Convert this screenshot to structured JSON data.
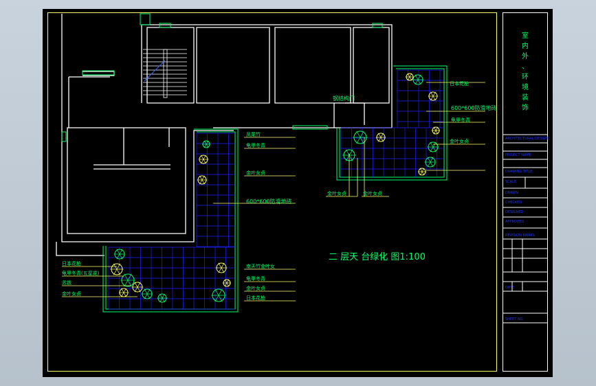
{
  "drawing": {
    "title": "二 层天 台绿化 图1:100",
    "labels": {
      "tile_top": "600*600防滑地砖",
      "tile_left": "600*600防滑地砖",
      "rect_room": "钢结构门",
      "right_r1": "日本花柏",
      "right_r2": "龟甲冬青",
      "right_r3": "金叶女贞",
      "center_t1": "凤尾竹",
      "center_t2": "龟甲冬青",
      "center_t3": "金叶女贞",
      "lower_bottom_l": "金叶女贞",
      "lower_bottom_r": "金叶女贞",
      "center_b1": "南天竹金叶女",
      "center_b2": "龟甲冬青",
      "center_b3": "金叶女贞",
      "center_b4": "日本花柏",
      "left_l1": "日本花柏",
      "left_l2": "龟甲冬青(五星花)",
      "left_l3": "苏铁",
      "left_l4": "金叶女贞"
    }
  },
  "titleblock": {
    "vertical": [
      "室",
      "内",
      "外",
      "、",
      "环",
      "境",
      "装",
      "饰"
    ],
    "rows": [
      "ARCHITECTURAL DESIGN",
      "PROJECT NAME",
      "DRAWING TITLE",
      "SCALE",
      "DRAWN",
      "CHECKED",
      "DESIGNED",
      "APPROVED",
      "REVISION MARKS",
      "DATE",
      "SHEET NO."
    ]
  },
  "colors": {
    "green": "#00ff66",
    "yellow": "#ffff66",
    "blue": "#2020ff",
    "white": "#ffffff",
    "background": "#000000"
  }
}
